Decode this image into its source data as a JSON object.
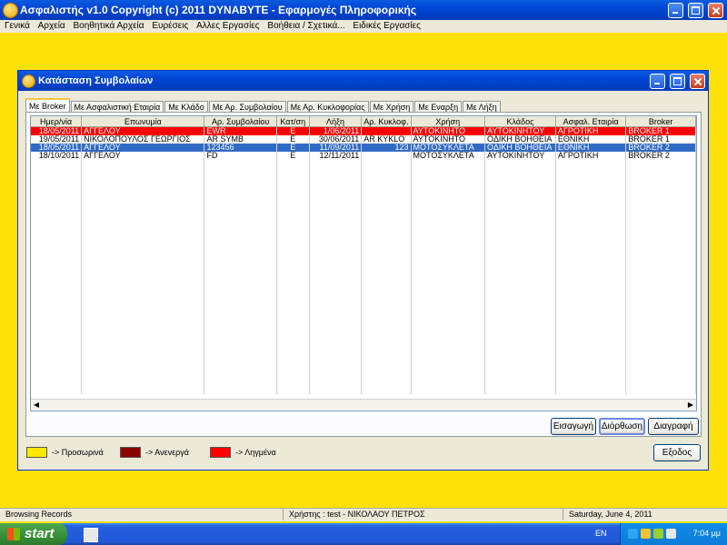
{
  "app": {
    "title": "Ασφαλιστής v1.0    Copyright (c) 2011 DYNABYTE - Εφαρμογές Πληροφορικής",
    "menu": [
      "Γενικά",
      "Αρχεία",
      "Βοηθητικά Αρχεία",
      "Ευρέσεις",
      "Αλλες Εργασίες",
      "Βοήθεια / Σχετικά...",
      "Ειδικές Εργασίες"
    ]
  },
  "dialog": {
    "title": "Κατάσταση Συμβολαίων",
    "tabs": [
      "Με Broker",
      "Με Ασφαλιστική Εταιρία",
      "Με Κλάδο",
      "Με Αρ. Συμβολαίου",
      "Με Αρ. Κυκλοφορίας",
      "Με Χρήση",
      "Με Εναρξη",
      "Με Λήξη"
    ],
    "columns": [
      "Ημερ/νία",
      "Επωνυμία",
      "Αρ. Συμβολαίου",
      "Κατ/ση",
      "Λήξη",
      "Αρ. Κυκλοφ.",
      "Χρήση",
      "Κλάδος",
      "Ασφαλ. Εταιρία",
      "Broker"
    ],
    "rows": [
      {
        "cells": [
          "18/05/2011",
          "ΑΓΓΕΛΟΥ",
          "EWR",
          "E",
          "1/06/2011",
          "",
          "ΑΥΤΟΚΙΝΗΤΟ",
          "ΑΥΤΟΚΙΝΗΤΟΥ",
          "ΑΓΡΟΤΙΚΗ",
          "BROKER 1"
        ],
        "state": "red"
      },
      {
        "cells": [
          "19/05/2011",
          "ΝΙΚΟΛΟΠΟΥΛΟΣ ΓΕΩΡΓΙΟΣ",
          "AR SYMB",
          "E",
          "30/06/2011",
          "AR KYKLO",
          "ΑΥΤΟΚΙΝΗΤΟ",
          "ΟΔΙΚΗ ΒΟΗΘΕΙΑ",
          "ΕΘΝΙΚΗ",
          "BROKER 1"
        ],
        "state": "normal"
      },
      {
        "cells": [
          "18/05/2011",
          "ΑΓΓΕΛΟΥ",
          "123456",
          "E",
          "11/09/2011",
          "123",
          "ΜΟΤΟΣΥΚΛΕΤΑ",
          "ΟΔΙΚΗ ΒΟΗΘΕΙΑ",
          "ΕΘΝΙΚΗ",
          "BROKER 2"
        ],
        "state": "selected"
      },
      {
        "cells": [
          "18/10/2011",
          "ΑΓΓΕΛΟΥ",
          "FD",
          "E",
          "12/11/2011",
          "",
          "ΜΟΤΟΣΥΚΛΕΤΑ",
          "ΑΥΤΟΚΙΝΗΤΟΥ",
          "ΑΓΡΟΤΙΚΗ",
          "BROKER 2"
        ],
        "state": "normal"
      }
    ],
    "buttons": {
      "insert": "Εισαγωγή",
      "edit": "Διόρθωση",
      "delete": "Διαγραφή",
      "exit": "Εξοδος"
    },
    "legend": [
      {
        "label": "-> Προσωρινά",
        "color": "#FFE800"
      },
      {
        "label": "-> Ανενεργά",
        "color": "#8B0000"
      },
      {
        "label": "-> Ληγμένα",
        "color": "#FF0000"
      }
    ]
  },
  "status": {
    "mode": "Browsing Records",
    "user": "Χρήστης : test  -  ΝΙΚΟΛΑΟΥ ΠΕΤΡΟΣ",
    "date": "Saturday, June  4, 2011"
  },
  "taskbar": {
    "start_label": "start",
    "lang": "EN",
    "clock": "7:04 μμ"
  },
  "colors": {
    "desktop": "#FFE10A",
    "title_bar": "#0046D5",
    "expired_row": "#FF0000",
    "selected_row": "#316AC5"
  }
}
